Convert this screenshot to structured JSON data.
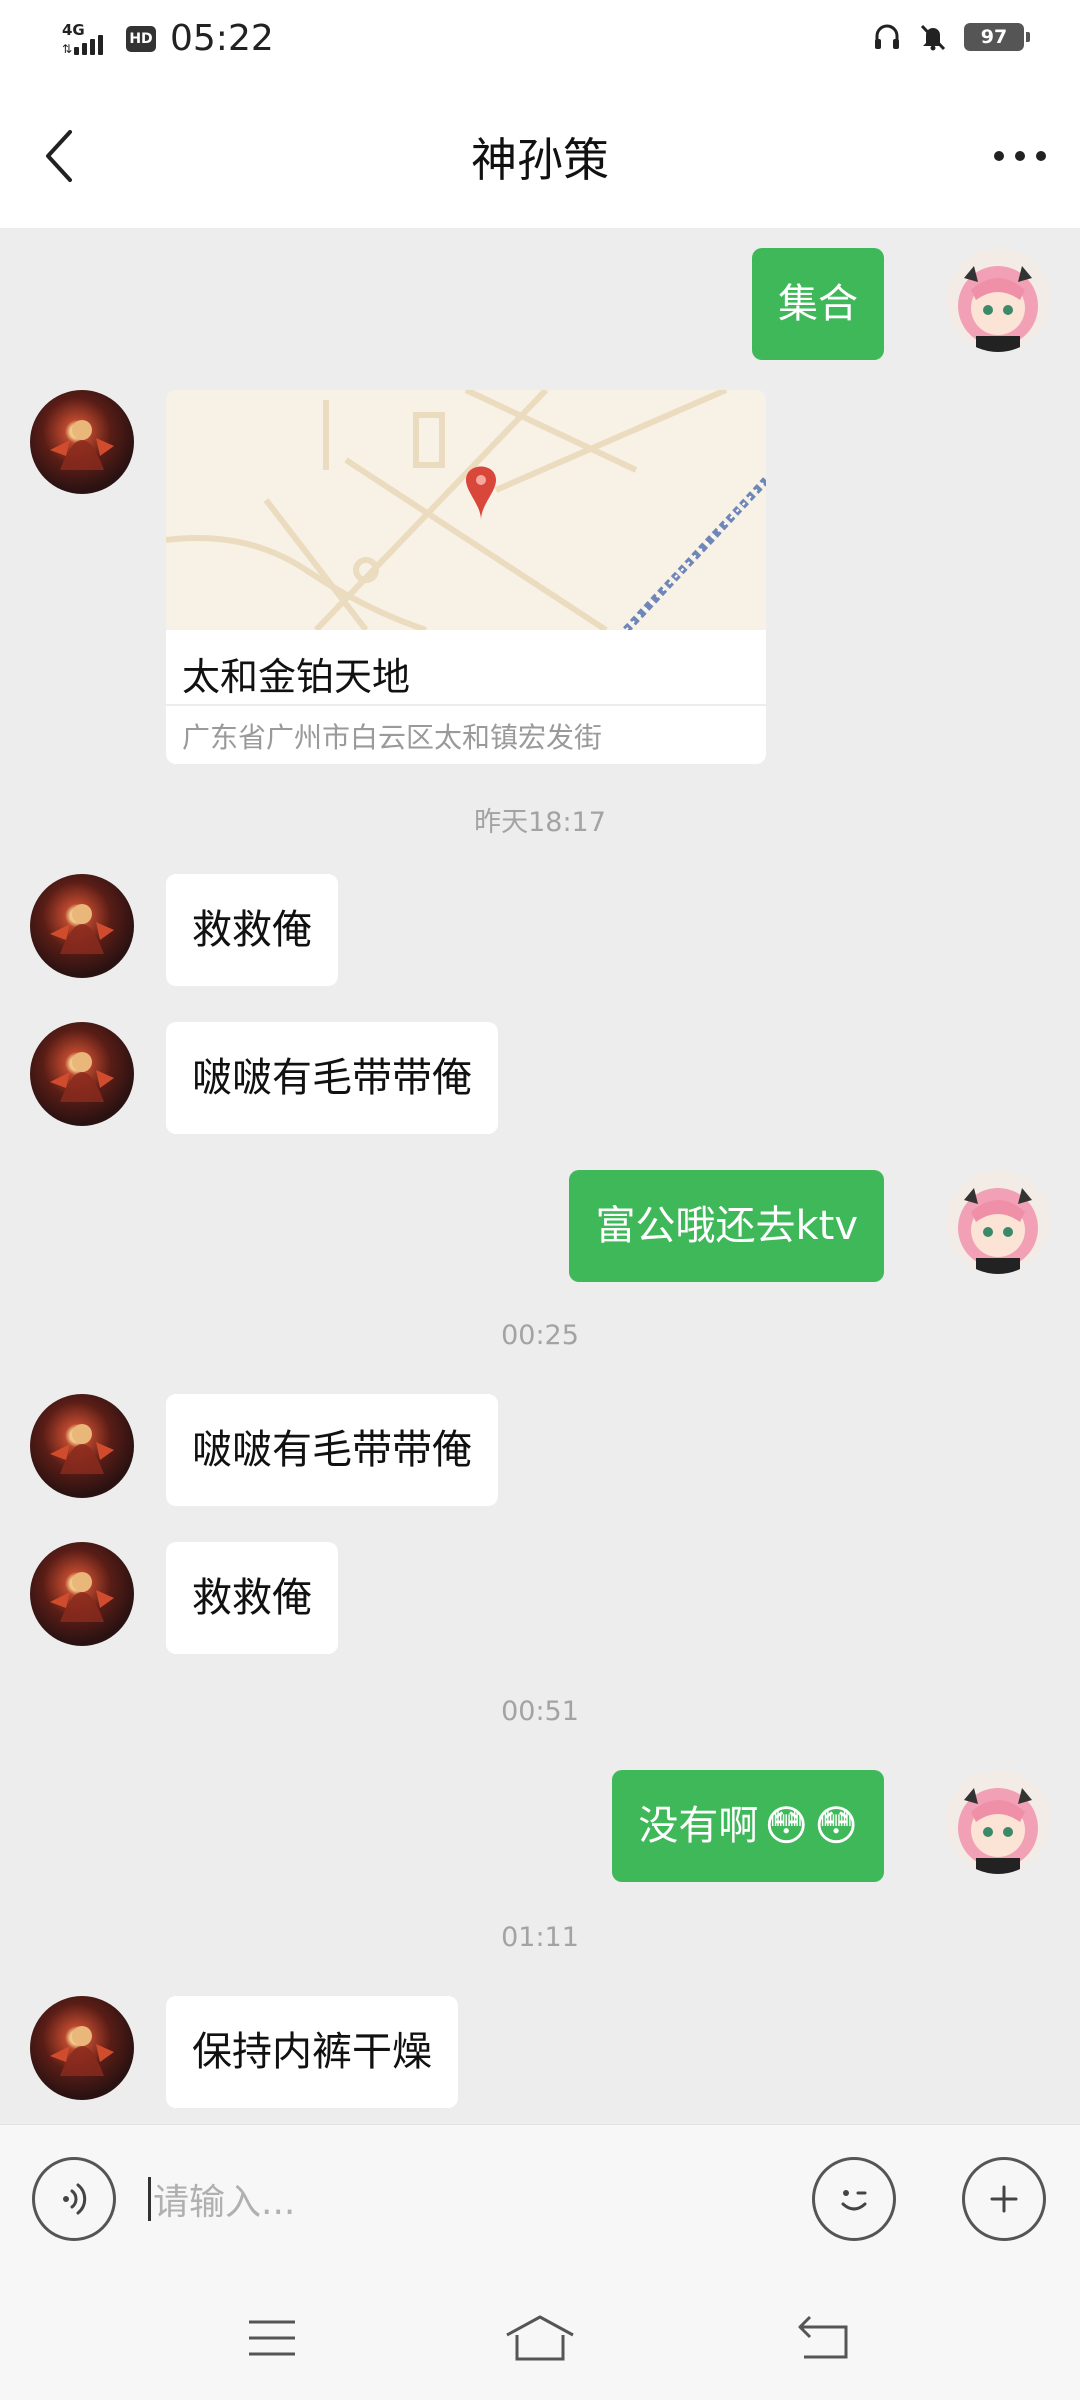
{
  "status_bar": {
    "network": "4G",
    "hd_label": "HD",
    "time": "05:22",
    "battery": "97"
  },
  "header": {
    "title": "神孙策"
  },
  "chat": {
    "messages": [
      {
        "side": "out",
        "text": "集合"
      },
      {
        "side": "in",
        "type": "location",
        "title": "太和金铂天地",
        "address": "广东省广州市白云区太和镇宏发街"
      },
      {
        "type": "time",
        "text": "昨天18:17"
      },
      {
        "side": "in",
        "text": "救救俺"
      },
      {
        "side": "in",
        "text": "啵啵有毛带带俺"
      },
      {
        "side": "out",
        "text": "富公哦还去ktv"
      },
      {
        "type": "time",
        "text": "00:25"
      },
      {
        "side": "in",
        "text": "啵啵有毛带带俺"
      },
      {
        "side": "in",
        "text": "救救俺"
      },
      {
        "type": "time",
        "text": "00:51"
      },
      {
        "side": "out",
        "text": "没有啊",
        "emoji": [
          "😳",
          "😳"
        ]
      },
      {
        "type": "time",
        "text": "01:11"
      },
      {
        "side": "in",
        "text": "保持内裤干燥"
      }
    ]
  },
  "input_bar": {
    "placeholder": "请输入..."
  },
  "icons": {
    "back": "back-arrow-icon",
    "more": "more-dots-icon",
    "voice": "voice-icon",
    "emoji": "emoji-icon",
    "plus": "plus-icon",
    "nav_menu": "menu-icon",
    "nav_home": "home-icon",
    "nav_back": "return-icon",
    "map_pin": "map-pin-icon"
  },
  "colors": {
    "sent_bubble": "#3fb85a",
    "received_bubble": "#ffffff",
    "chat_background": "#ededed"
  }
}
